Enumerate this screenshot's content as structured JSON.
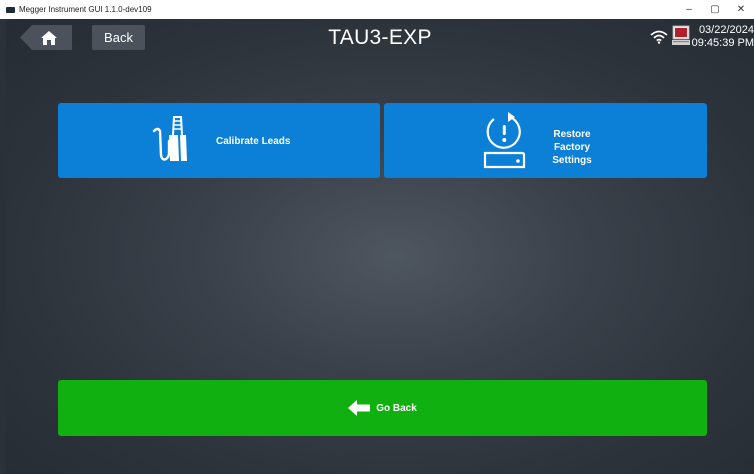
{
  "window": {
    "title": "Megger Instrument GUI 1.1.0-dev109",
    "controls": {
      "minimize": "–",
      "maximize": "▢",
      "close": "✕"
    }
  },
  "header": {
    "home_icon": "home-icon",
    "back_label": "Back",
    "title": "TAU3-EXP",
    "status": {
      "wifi_icon": "wifi-icon",
      "device_icon": "instrument-connection-icon",
      "date": "03/22/2024",
      "time": "09:45:39 PM"
    }
  },
  "main": {
    "tiles": [
      {
        "label": "Calibrate Leads",
        "icon": "test-leads-icon"
      },
      {
        "label": "Restore Factory Settings",
        "icon": "restore-factory-icon"
      }
    ],
    "go_back": {
      "label": "Go Back",
      "icon": "arrow-left-icon"
    }
  },
  "colors": {
    "tile_blue": "#0c7fd6",
    "go_back_green": "#10b010",
    "button_gray": "#4b525b",
    "background": "#2b3138"
  }
}
